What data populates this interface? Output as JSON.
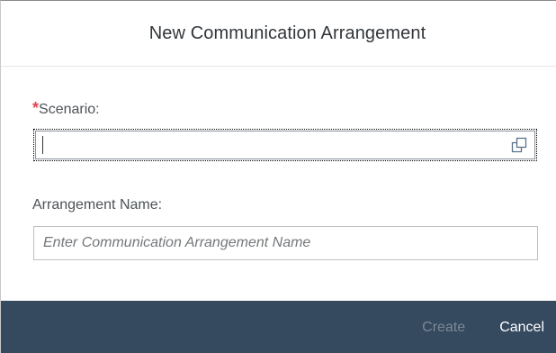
{
  "dialog": {
    "title": "New Communication Arrangement"
  },
  "form": {
    "scenario": {
      "required_marker": "*",
      "label": "Scenario:",
      "value": "",
      "value_help_icon": "value-help-icon"
    },
    "arrangement_name": {
      "label": "Arrangement Name:",
      "value": "",
      "placeholder": "Enter Communication Arrangement Name"
    }
  },
  "footer": {
    "create_label": "Create",
    "create_enabled": false,
    "cancel_label": "Cancel"
  },
  "colors": {
    "footer_background": "#354a5f",
    "required_star": "#e34352",
    "disabled_button_text": "#7a8896",
    "active_button_text": "#ffffff"
  }
}
